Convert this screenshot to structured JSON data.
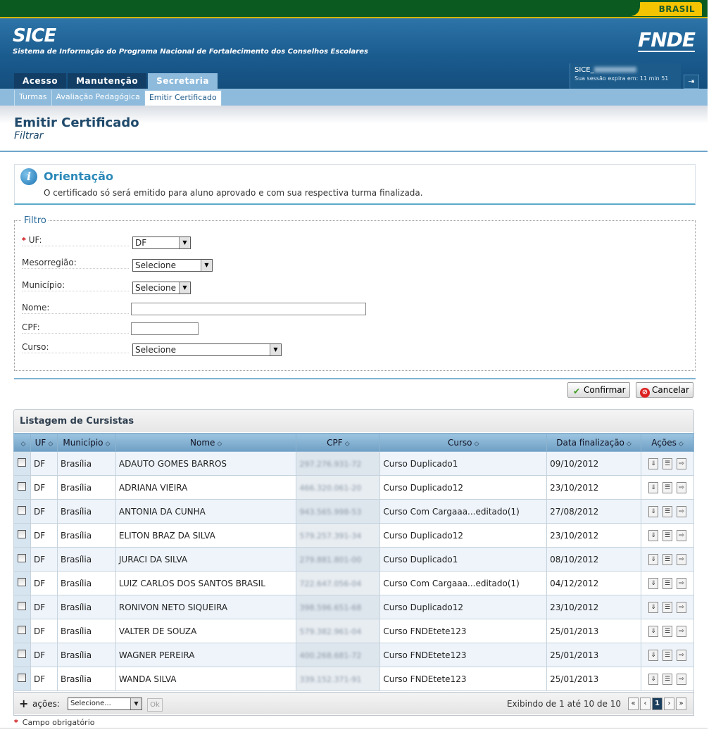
{
  "brand": {
    "brasil": "BRASIL",
    "app_title": "SICE",
    "app_subtitle": "Sistema de Informação do Programa Nacional de Fortalecimento dos Conselhos Escolares",
    "logo": "FNDE"
  },
  "session": {
    "user": "SICE_",
    "expires": "Sua sessão expira em: 11 min 51"
  },
  "main_tabs": [
    "Acesso",
    "Manutenção",
    "Secretaria"
  ],
  "sub_tabs": [
    "Turmas",
    "Avaliação Pedagógica",
    "Emitir Certificado"
  ],
  "page": {
    "title": "Emitir Certificado",
    "subtitle": "Filtrar"
  },
  "orientation": {
    "title": "Orientação",
    "text": "O certificado só será emitido para aluno aprovado e com sua respectiva turma finalizada."
  },
  "filter": {
    "legend": "Filtro",
    "uf_label": "UF:",
    "uf_value": "DF",
    "meso_label": "Mesorregião:",
    "meso_value": "Selecione",
    "mun_label": "Município:",
    "mun_value": "Selecione",
    "nome_label": "Nome:",
    "nome_value": "",
    "cpf_label": "CPF:",
    "cpf_value": "",
    "curso_label": "Curso:",
    "curso_value": "Selecione"
  },
  "buttons": {
    "confirm": "Confirmar",
    "cancel": "Cancelar"
  },
  "listing": {
    "title": "Listagem de Cursistas",
    "headers": [
      "UF",
      "Município",
      "Nome",
      "CPF",
      "Curso",
      "Data finalização",
      "Ações"
    ],
    "rows": [
      {
        "uf": "DF",
        "mun": "Brasília",
        "nome": "ADAUTO GOMES BARROS",
        "cpf": "297.276.931-72",
        "curso": "Curso Duplicado1",
        "data": "09/10/2012"
      },
      {
        "uf": "DF",
        "mun": "Brasília",
        "nome": "ADRIANA VIEIRA",
        "cpf": "466.320.061-20",
        "curso": "Curso Duplicado12",
        "data": "23/10/2012"
      },
      {
        "uf": "DF",
        "mun": "Brasília",
        "nome": "ANTONIA DA CUNHA",
        "cpf": "943.565.998-53",
        "curso": "Curso Com Cargaaa...editado(1)",
        "data": "27/08/2012"
      },
      {
        "uf": "DF",
        "mun": "Brasília",
        "nome": "ELITON BRAZ DA SILVA",
        "cpf": "579.257.391-34",
        "curso": "Curso Duplicado12",
        "data": "23/10/2012"
      },
      {
        "uf": "DF",
        "mun": "Brasília",
        "nome": "JURACI DA SILVA",
        "cpf": "279.881.801-00",
        "curso": "Curso Duplicado1",
        "data": "08/10/2012"
      },
      {
        "uf": "DF",
        "mun": "Brasília",
        "nome": "LUIZ CARLOS DOS SANTOS BRASIL",
        "cpf": "722.647.056-04",
        "curso": "Curso Com Cargaaa...editado(1)",
        "data": "04/12/2012"
      },
      {
        "uf": "DF",
        "mun": "Brasília",
        "nome": "RONIVON NETO SIQUEIRA",
        "cpf": "398.596.651-68",
        "curso": "Curso Duplicado12",
        "data": "23/10/2012"
      },
      {
        "uf": "DF",
        "mun": "Brasília",
        "nome": "VALTER DE SOUZA",
        "cpf": "579.382.961-04",
        "curso": "Curso FNDEtete123",
        "data": "25/01/2013"
      },
      {
        "uf": "DF",
        "mun": "Brasília",
        "nome": "WAGNER PEREIRA",
        "cpf": "400.268.681-72",
        "curso": "Curso FNDEtete123",
        "data": "25/01/2013"
      },
      {
        "uf": "DF",
        "mun": "Brasília",
        "nome": "WANDA SILVA",
        "cpf": "339.152.371-91",
        "curso": "Curso FNDEtete123",
        "data": "25/01/2013"
      }
    ],
    "footer": {
      "acoes_label": "ações:",
      "acoes_select": "Selecione...",
      "ok": "Ok",
      "showing": "Exibindo de 1 até 10 de 10",
      "page": "1"
    }
  },
  "required_note": "Campo obrigatório"
}
